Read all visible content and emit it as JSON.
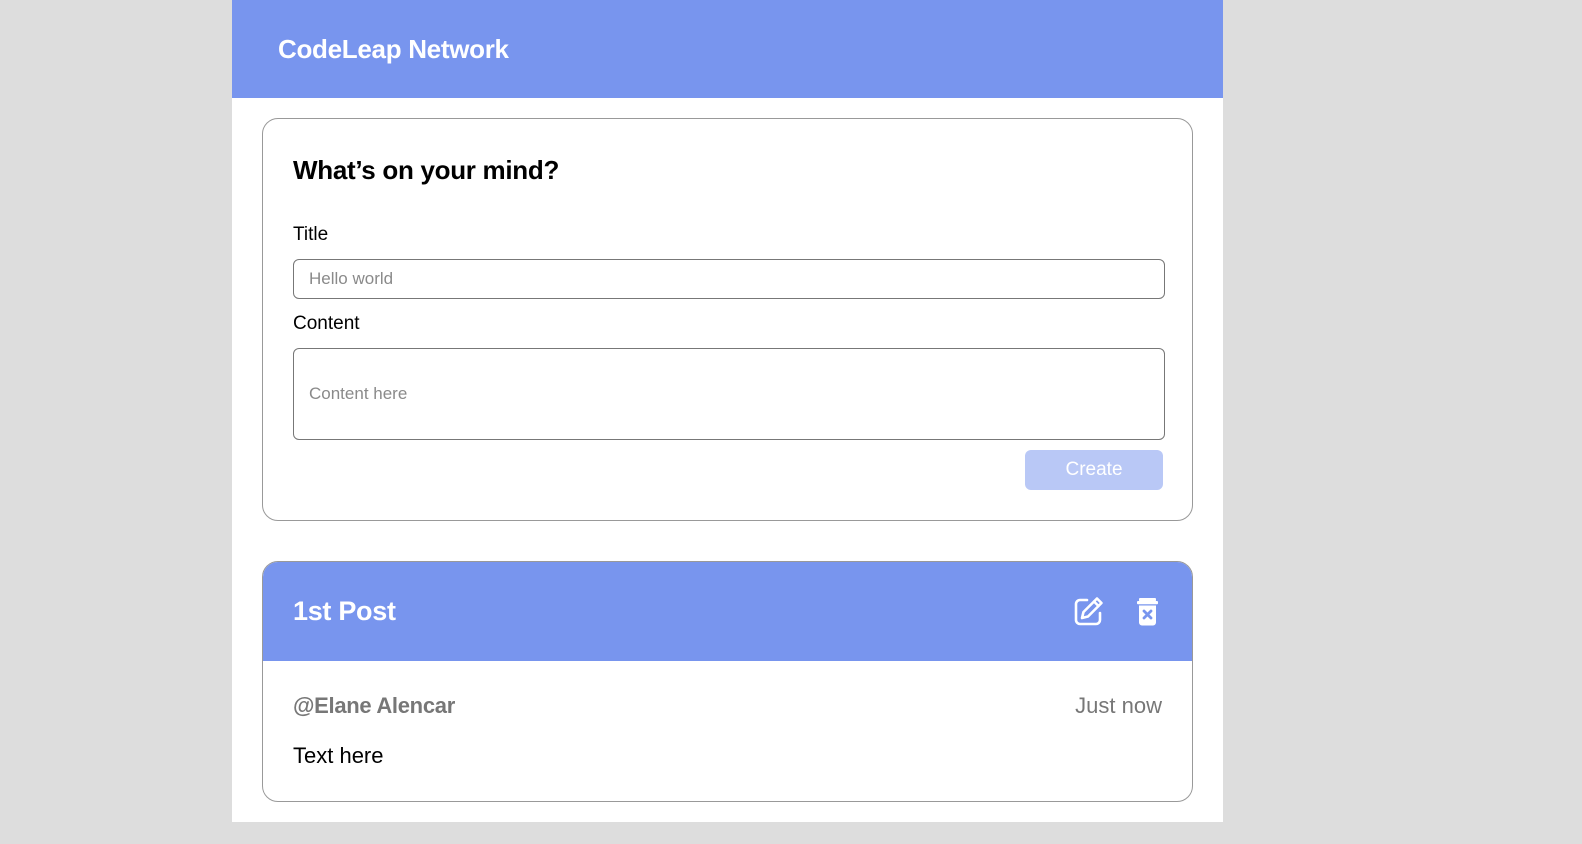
{
  "app": {
    "title": "CodeLeap Network"
  },
  "create_form": {
    "heading": "What’s on your mind?",
    "title_label": "Title",
    "title_placeholder": "Hello world",
    "title_value": "",
    "content_label": "Content",
    "content_placeholder": "Content here",
    "content_value": "",
    "create_label": "Create"
  },
  "posts": [
    {
      "title": "1st Post",
      "author": "@Elane Alencar",
      "time": "Just now",
      "content": "Text here",
      "edit_icon": "edit-icon",
      "delete_icon": "trash-icon"
    }
  ],
  "colors": {
    "accent": "#7895ee",
    "button_disabled": "#b9c8f6",
    "background": "#dddddd"
  }
}
